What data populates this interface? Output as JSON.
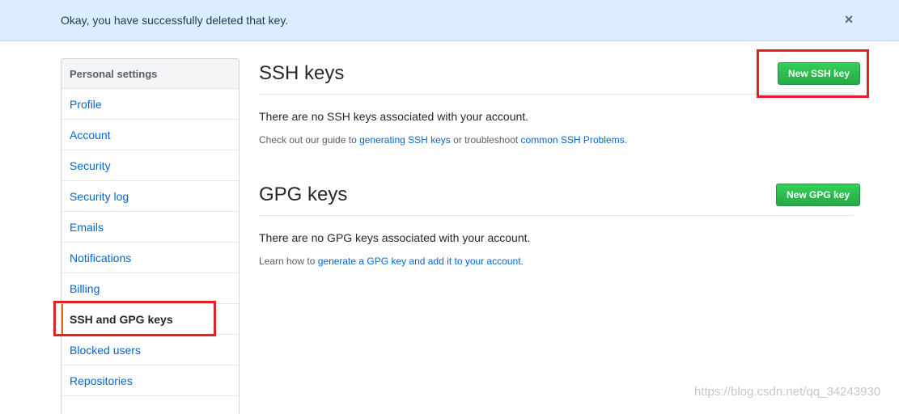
{
  "flash": {
    "message": "Okay, you have successfully deleted that key.",
    "close_icon": "×"
  },
  "sidebar": {
    "header": "Personal settings",
    "items": [
      {
        "label": "Profile"
      },
      {
        "label": "Account"
      },
      {
        "label": "Security"
      },
      {
        "label": "Security log"
      },
      {
        "label": "Emails"
      },
      {
        "label": "Notifications"
      },
      {
        "label": "Billing"
      },
      {
        "label": "SSH and GPG keys",
        "selected": true
      },
      {
        "label": "Blocked users"
      },
      {
        "label": "Repositories"
      }
    ]
  },
  "ssh": {
    "title": "SSH keys",
    "new_button": "New SSH key",
    "blank": "There are no SSH keys associated with your account.",
    "note_prefix": "Check out our guide to ",
    "link1": "generating SSH keys",
    "note_middle": " or troubleshoot ",
    "link2": "common SSH Problems",
    "note_suffix": "."
  },
  "gpg": {
    "title": "GPG keys",
    "new_button": "New GPG key",
    "blank": "There are no GPG keys associated with your account.",
    "note_prefix": "Learn how to ",
    "link": "generate a GPG key and add it to your account",
    "note_suffix": "."
  },
  "watermark": "https://blog.csdn.net/qq_34243930",
  "colors": {
    "accent_link": "#0366d6",
    "button_green": "#28a745",
    "highlight_red": "#e3202a",
    "flash_bg": "#dbedff"
  }
}
